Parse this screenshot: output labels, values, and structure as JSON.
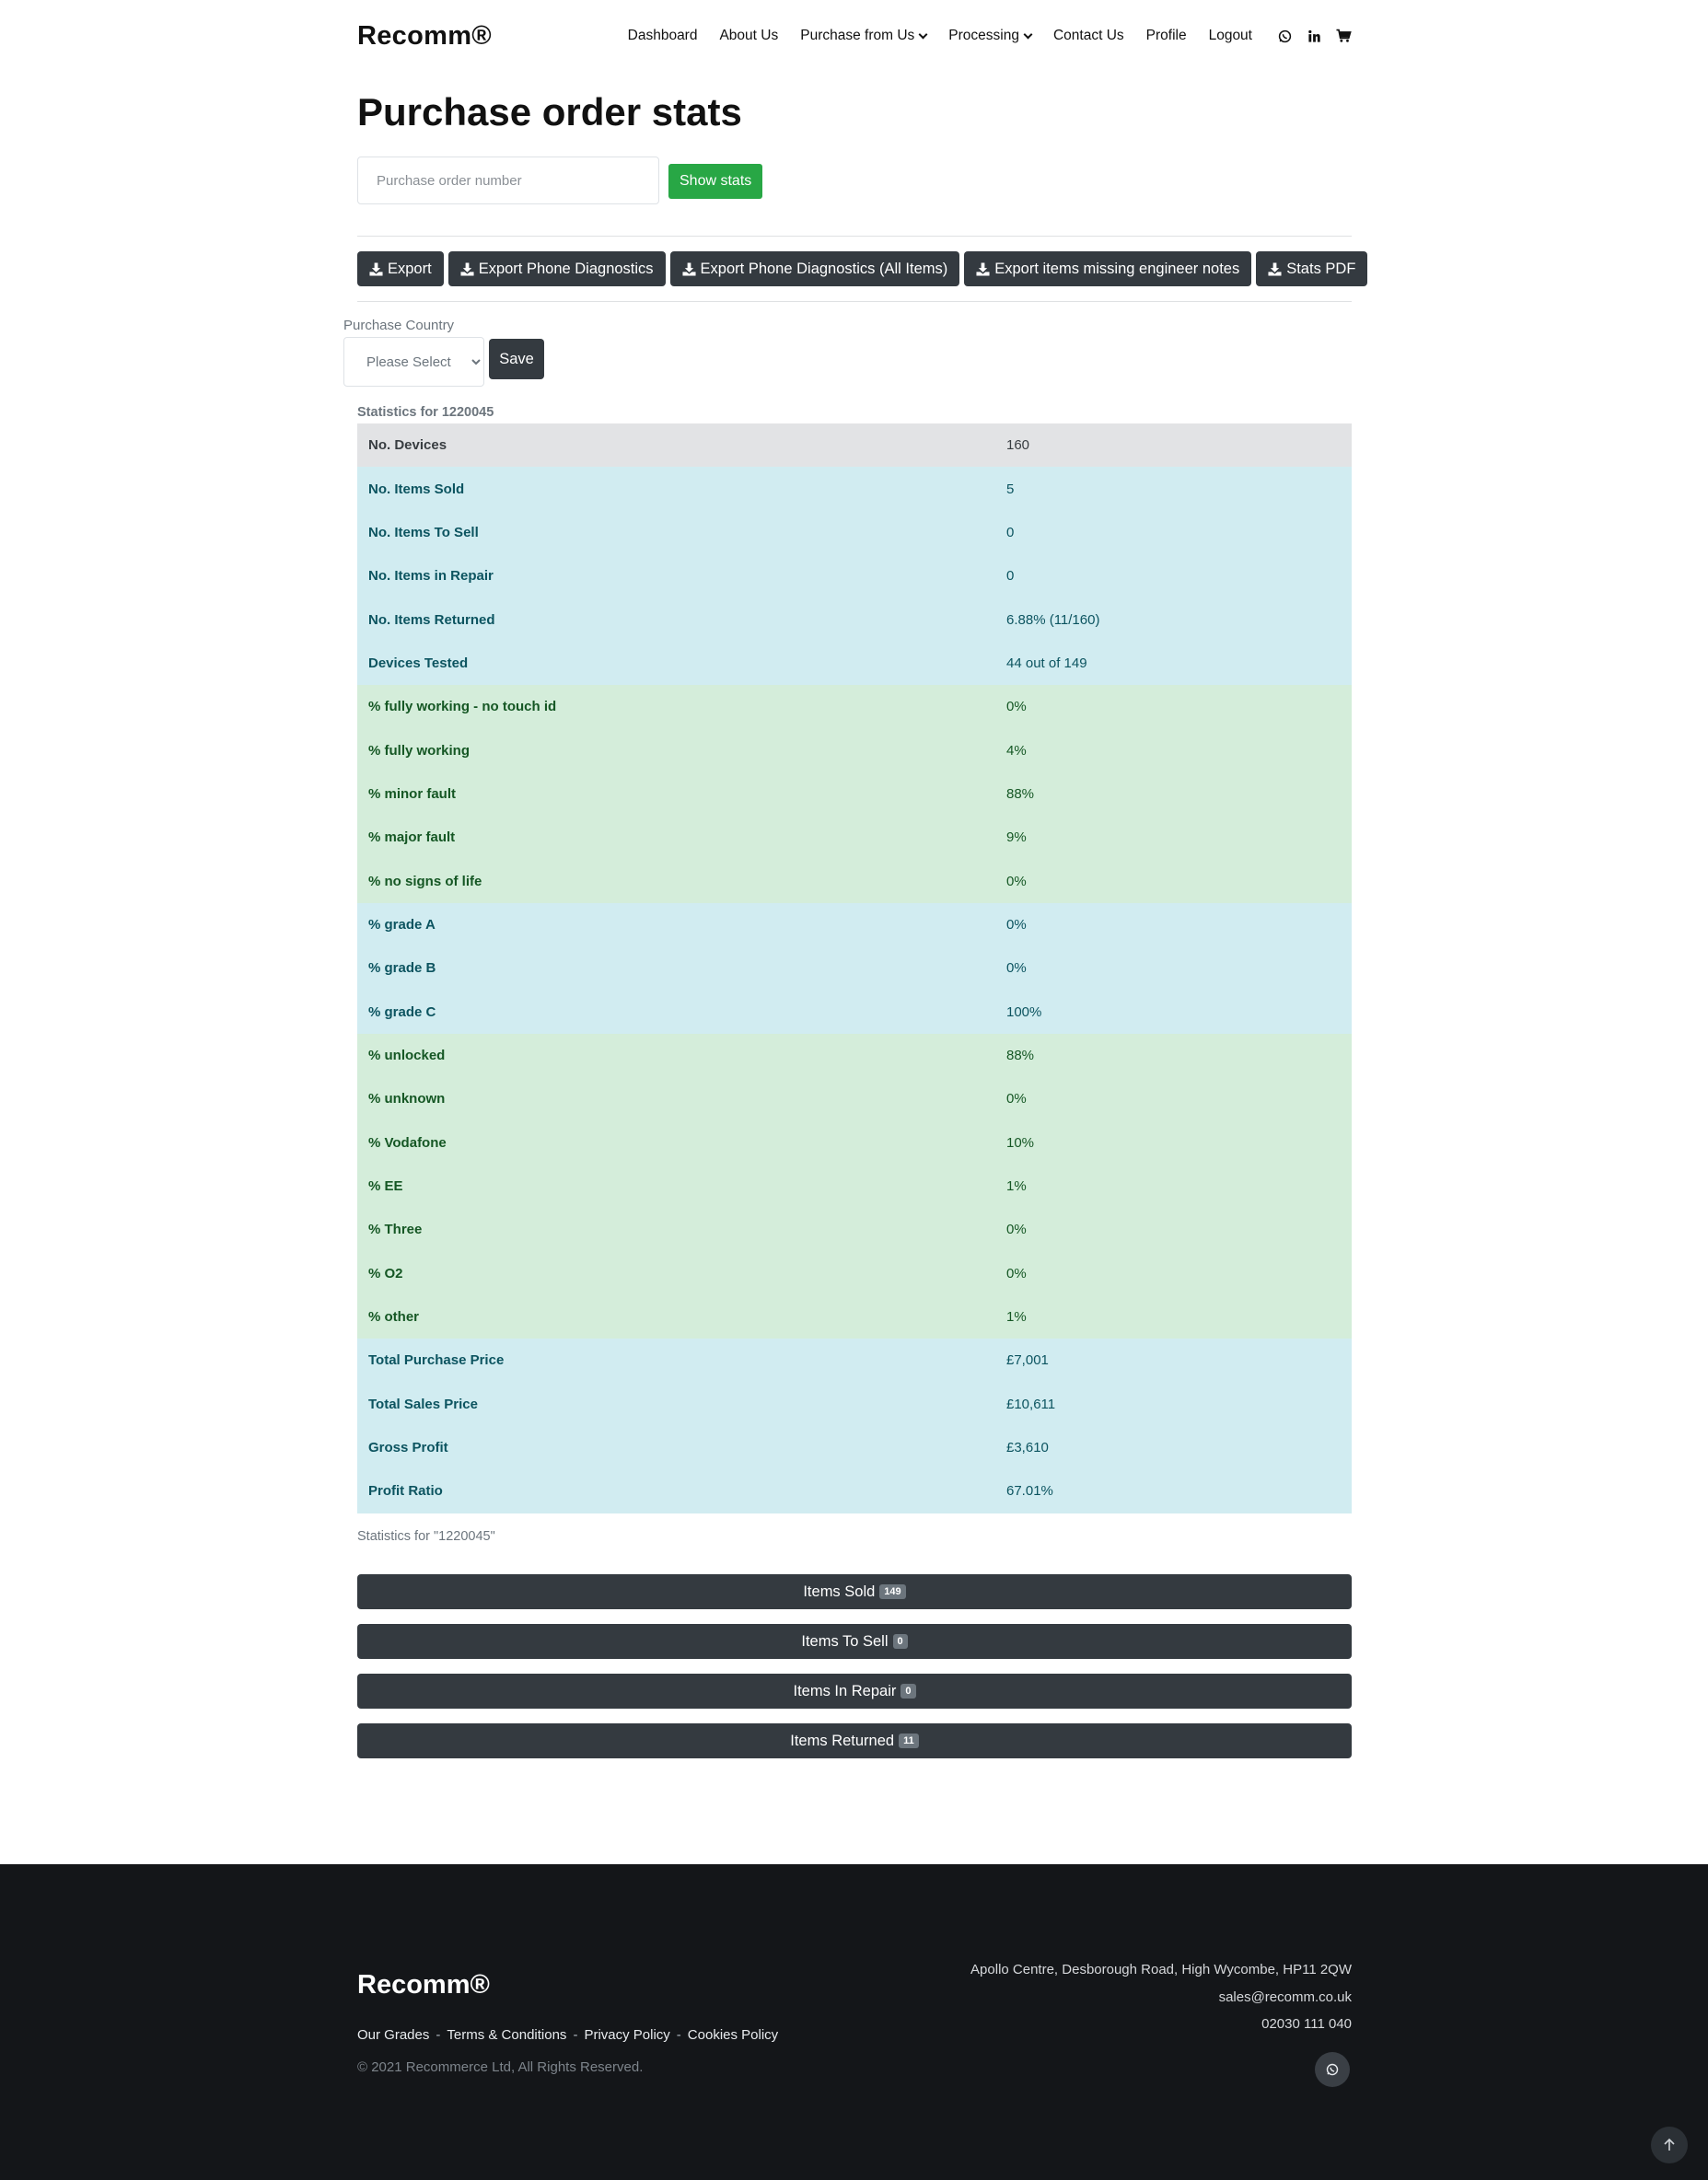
{
  "nav": {
    "brand": "Recomm®",
    "items": [
      "Dashboard",
      "About Us",
      "Purchase from Us",
      "Processing",
      "Contact Us",
      "Profile",
      "Logout"
    ],
    "icons": [
      "whatsapp-icon",
      "linkedin-icon",
      "cart-icon"
    ]
  },
  "page": {
    "title": "Purchase order stats",
    "po_placeholder": "Purchase order number",
    "show_stats": "Show stats"
  },
  "exports": {
    "export": "Export",
    "phone_diag": "Export Phone Diagnostics",
    "phone_diag_all": "Export Phone Diagnostics (All Items)",
    "missing_notes": "Export items missing engineer notes",
    "stats_pdf": "Stats PDF"
  },
  "purchase_country": {
    "label": "Purchase Country",
    "selected": "Please Select",
    "save": "Save"
  },
  "stats": {
    "caption": "Statistics for 1220045",
    "footer": "Statistics for \"1220045\"",
    "rows": [
      {
        "k": "No. Devices",
        "v": "160",
        "style": "secondary"
      },
      {
        "k": "No. Items Sold",
        "v": "5",
        "style": "info"
      },
      {
        "k": "No. Items To Sell",
        "v": "0",
        "style": "info"
      },
      {
        "k": "No. Items in Repair",
        "v": "0",
        "style": "info"
      },
      {
        "k": "No. Items Returned",
        "v": "6.88% (11/160)",
        "style": "info"
      },
      {
        "k": "Devices Tested",
        "v": "44 out of 149",
        "style": "info"
      },
      {
        "k": "% fully working - no touch id",
        "v": "0%",
        "style": "success"
      },
      {
        "k": "% fully working",
        "v": "4%",
        "style": "success"
      },
      {
        "k": "% minor fault",
        "v": "88%",
        "style": "success"
      },
      {
        "k": "% major fault",
        "v": "9%",
        "style": "success"
      },
      {
        "k": "% no signs of life",
        "v": "0%",
        "style": "success"
      },
      {
        "k": "% grade A",
        "v": "0%",
        "style": "info"
      },
      {
        "k": "% grade B",
        "v": "0%",
        "style": "info"
      },
      {
        "k": "% grade C",
        "v": "100%",
        "style": "info"
      },
      {
        "k": "% unlocked",
        "v": "88%",
        "style": "success"
      },
      {
        "k": "% unknown",
        "v": "0%",
        "style": "success"
      },
      {
        "k": "% Vodafone",
        "v": "10%",
        "style": "success"
      },
      {
        "k": "% EE",
        "v": "1%",
        "style": "success"
      },
      {
        "k": "% Three",
        "v": "0%",
        "style": "success"
      },
      {
        "k": "% O2",
        "v": "0%",
        "style": "success"
      },
      {
        "k": "% other",
        "v": "1%",
        "style": "success"
      },
      {
        "k": "Total Purchase Price",
        "v": "£7,001",
        "style": "info"
      },
      {
        "k": "Total Sales Price",
        "v": "£10,611",
        "style": "info"
      },
      {
        "k": "Gross Profit",
        "v": "£3,610",
        "style": "info"
      },
      {
        "k": "Profit Ratio",
        "v": "67.01%",
        "style": "info"
      }
    ]
  },
  "sections": [
    {
      "label": "Items Sold",
      "count": "149"
    },
    {
      "label": "Items To Sell",
      "count": "0"
    },
    {
      "label": "Items In Repair",
      "count": "0"
    },
    {
      "label": "Items Returned",
      "count": "11"
    }
  ],
  "footer": {
    "brand": "Recomm®",
    "links": [
      "Our Grades",
      "Terms & Conditions",
      "Privacy Policy",
      "Cookies Policy"
    ],
    "copyright": "© 2021 Recommerce Ltd, All Rights Reserved.",
    "address": "Apollo Centre, Desborough Road, High Wycombe, HP11 2QW",
    "email": "sales@recomm.co.uk",
    "phone": "02030 111 040"
  }
}
